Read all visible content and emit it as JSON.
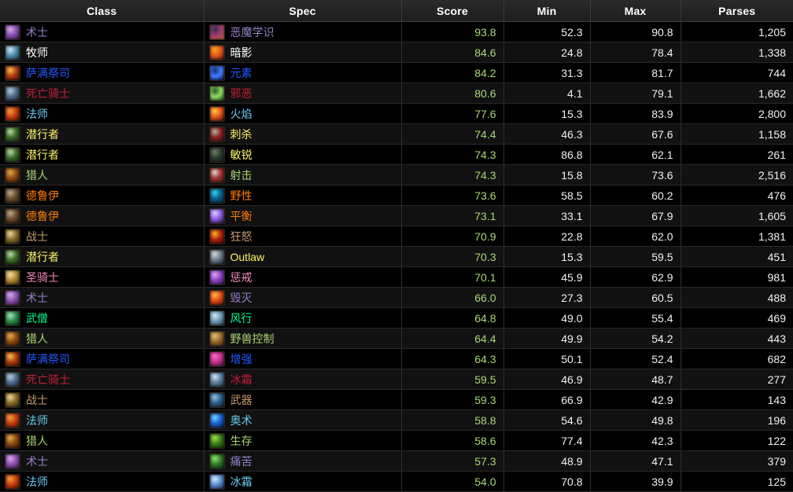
{
  "table": {
    "columns": [
      {
        "key": "class",
        "label": "Class",
        "align": "center"
      },
      {
        "key": "spec",
        "label": "Spec",
        "align": "center"
      },
      {
        "key": "score",
        "label": "Score",
        "align": "center"
      },
      {
        "key": "min",
        "label": "Min",
        "align": "center"
      },
      {
        "key": "max",
        "label": "Max",
        "align": "center"
      },
      {
        "key": "parses",
        "label": "Parses",
        "align": "center"
      }
    ],
    "class_colors": {
      "warlock": "#9482C9",
      "priest": "#FFFFFF",
      "shaman": "#2459FF",
      "deathknight": "#C41E3A",
      "mage": "#69CCF0",
      "rogue": "#FFF569",
      "hunter": "#ABD473",
      "druid": "#FF7D0A",
      "warrior": "#C79C6E",
      "paladin": "#F58CBA",
      "monk": "#00FF96"
    },
    "icon_colors": {
      "demonology": "#3b2a4d,#9a3f6f,#e05a3a",
      "shadow": "#f2a81c,#e2541c,#3a0d06",
      "elemental": "#1b2e7a,#3f7bff,#0a1030",
      "unholy": "#2e5a22,#8ddc63,#133010",
      "fire": "#f7c94a,#e8561a,#2a0a04",
      "assassination": "#b5b0a4,#8a2020,#2a1412",
      "subtlety": "#6d7f63,#2a3a2c,#121a12",
      "marksmanship": "#d8d2c4,#a33030,#2b1a12",
      "feral": "#2fd0e8,#0b5c8c,#06202e",
      "balance": "#d9c9ff,#8a5adf,#1a1030",
      "fury": "#f2b21c,#b02010,#2a0a06",
      "outlaw": "#cfd6dc,#6a7a86,#1b2228",
      "retribution": "#d6a8ef,#8a3fc0,#24123a",
      "destruction": "#ffb347,#e04a18,#2c0c04",
      "windwalker": "#cfe6f2,#6f9ab5,#1d2b33",
      "beastmastery": "#e0c07a,#9a6a2a,#2a1c0c",
      "enhancement": "#ff66c4,#c4308a,#2e0c22",
      "frostdk": "#cfe3f5,#5a7f9c,#18242e",
      "arms": "#8fbfe0,#2a5f8a,#0d1a24",
      "arcane": "#6fd2ff,#1a5fd0,#061430",
      "survival": "#9ae04a,#3a7a18,#102a06",
      "affliction": "#8fe06a,#2e7a2a,#0c2410",
      "frostmage": "#cfe8ff,#5a8fd0,#101e38",
      "warlock_c": "#d9a8e8,#8a4fb0,#2a1238",
      "priest_c": "#cfe8f5,#4a8aa8,#14242e",
      "shaman_c": "#f2c04a,#b03a10,#2e0e04",
      "deathknight_c": "#b8c8d8,#4a6a8a,#101c26",
      "mage_c": "#f2a03a,#c43a10,#2e0c04",
      "rogue_c": "#b8d8a8,#3a6a2a,#0e2008",
      "hunter_c": "#e0a84a,#8a4a10,#241004",
      "druid_c": "#b8a88a,#6a4a2a,#1e1408",
      "warrior_c": "#e8d89a,#8a6a2a,#241a08",
      "paladin_c": "#f2e0a8,#b08a30,#2a200a",
      "monk_c": "#a8e0b8,#2a8a4a,#0a2414"
    },
    "rows": [
      {
        "class": "术士",
        "class_key": "warlock",
        "class_icon": "warlock_c",
        "spec": "恶魔学识",
        "spec_icon": "demonology",
        "score": "93.8",
        "min": "52.3",
        "max": "90.8",
        "parses": "1,205"
      },
      {
        "class": "牧师",
        "class_key": "priest",
        "class_icon": "priest_c",
        "spec": "暗影",
        "spec_icon": "shadow",
        "score": "84.6",
        "min": "24.8",
        "max": "78.4",
        "parses": "1,338"
      },
      {
        "class": "萨满祭司",
        "class_key": "shaman",
        "class_icon": "shaman_c",
        "spec": "元素",
        "spec_icon": "elemental",
        "score": "84.2",
        "min": "31.3",
        "max": "81.7",
        "parses": "744"
      },
      {
        "class": "死亡骑士",
        "class_key": "deathknight",
        "class_icon": "deathknight_c",
        "spec": "邪恶",
        "spec_icon": "unholy",
        "score": "80.6",
        "min": "4.1",
        "max": "79.1",
        "parses": "1,662"
      },
      {
        "class": "法师",
        "class_key": "mage",
        "class_icon": "mage_c",
        "spec": "火焰",
        "spec_icon": "fire",
        "score": "77.6",
        "min": "15.3",
        "max": "83.9",
        "parses": "2,800"
      },
      {
        "class": "潜行者",
        "class_key": "rogue",
        "class_icon": "rogue_c",
        "spec": "刺杀",
        "spec_icon": "assassination",
        "score": "74.4",
        "min": "46.3",
        "max": "67.6",
        "parses": "1,158"
      },
      {
        "class": "潜行者",
        "class_key": "rogue",
        "class_icon": "rogue_c",
        "spec": "敏锐",
        "spec_icon": "subtlety",
        "score": "74.3",
        "min": "86.8",
        "max": "62.1",
        "parses": "261"
      },
      {
        "class": "猎人",
        "class_key": "hunter",
        "class_icon": "hunter_c",
        "spec": "射击",
        "spec_icon": "marksmanship",
        "score": "74.3",
        "min": "15.8",
        "max": "73.6",
        "parses": "2,516"
      },
      {
        "class": "德鲁伊",
        "class_key": "druid",
        "class_icon": "druid_c",
        "spec": "野性",
        "spec_icon": "feral",
        "score": "73.6",
        "min": "58.5",
        "max": "60.2",
        "parses": "476"
      },
      {
        "class": "德鲁伊",
        "class_key": "druid",
        "class_icon": "druid_c",
        "spec": "平衡",
        "spec_icon": "balance",
        "score": "73.1",
        "min": "33.1",
        "max": "67.9",
        "parses": "1,605"
      },
      {
        "class": "战士",
        "class_key": "warrior",
        "class_icon": "warrior_c",
        "spec": "狂怒",
        "spec_icon": "fury",
        "score": "70.9",
        "min": "22.8",
        "max": "62.0",
        "parses": "1,381"
      },
      {
        "class": "潜行者",
        "class_key": "rogue",
        "class_icon": "rogue_c",
        "spec": "Outlaw",
        "spec_icon": "outlaw",
        "score": "70.3",
        "min": "15.3",
        "max": "59.5",
        "parses": "451"
      },
      {
        "class": "圣骑士",
        "class_key": "paladin",
        "class_icon": "paladin_c",
        "spec": "惩戒",
        "spec_icon": "retribution",
        "score": "70.1",
        "min": "45.9",
        "max": "62.9",
        "parses": "981"
      },
      {
        "class": "术士",
        "class_key": "warlock",
        "class_icon": "warlock_c",
        "spec": "毁灭",
        "spec_icon": "destruction",
        "score": "66.0",
        "min": "27.3",
        "max": "60.5",
        "parses": "488"
      },
      {
        "class": "武僧",
        "class_key": "monk",
        "class_icon": "monk_c",
        "spec": "风行",
        "spec_icon": "windwalker",
        "score": "64.8",
        "min": "49.0",
        "max": "55.4",
        "parses": "469"
      },
      {
        "class": "猎人",
        "class_key": "hunter",
        "class_icon": "hunter_c",
        "spec": "野兽控制",
        "spec_icon": "beastmastery",
        "score": "64.4",
        "min": "49.9",
        "max": "54.2",
        "parses": "443"
      },
      {
        "class": "萨满祭司",
        "class_key": "shaman",
        "class_icon": "shaman_c",
        "spec": "增强",
        "spec_icon": "enhancement",
        "score": "64.3",
        "min": "50.1",
        "max": "52.4",
        "parses": "682"
      },
      {
        "class": "死亡骑士",
        "class_key": "deathknight",
        "class_icon": "deathknight_c",
        "spec": "冰霜",
        "spec_icon": "frostdk",
        "score": "59.5",
        "min": "46.9",
        "max": "48.7",
        "parses": "277"
      },
      {
        "class": "战士",
        "class_key": "warrior",
        "class_icon": "warrior_c",
        "spec": "武器",
        "spec_icon": "arms",
        "score": "59.3",
        "min": "66.9",
        "max": "42.9",
        "parses": "143"
      },
      {
        "class": "法师",
        "class_key": "mage",
        "class_icon": "mage_c",
        "spec": "奥术",
        "spec_icon": "arcane",
        "score": "58.8",
        "min": "54.6",
        "max": "49.8",
        "parses": "196"
      },
      {
        "class": "猎人",
        "class_key": "hunter",
        "class_icon": "hunter_c",
        "spec": "生存",
        "spec_icon": "survival",
        "score": "58.6",
        "min": "77.4",
        "max": "42.3",
        "parses": "122"
      },
      {
        "class": "术士",
        "class_key": "warlock",
        "class_icon": "warlock_c",
        "spec": "痛苦",
        "spec_icon": "affliction",
        "score": "57.3",
        "min": "48.9",
        "max": "47.1",
        "parses": "379"
      },
      {
        "class": "法师",
        "class_key": "mage",
        "class_icon": "mage_c",
        "spec": "冰霜",
        "spec_icon": "frostmage",
        "score": "54.0",
        "min": "70.8",
        "max": "39.9",
        "parses": "125"
      }
    ]
  }
}
